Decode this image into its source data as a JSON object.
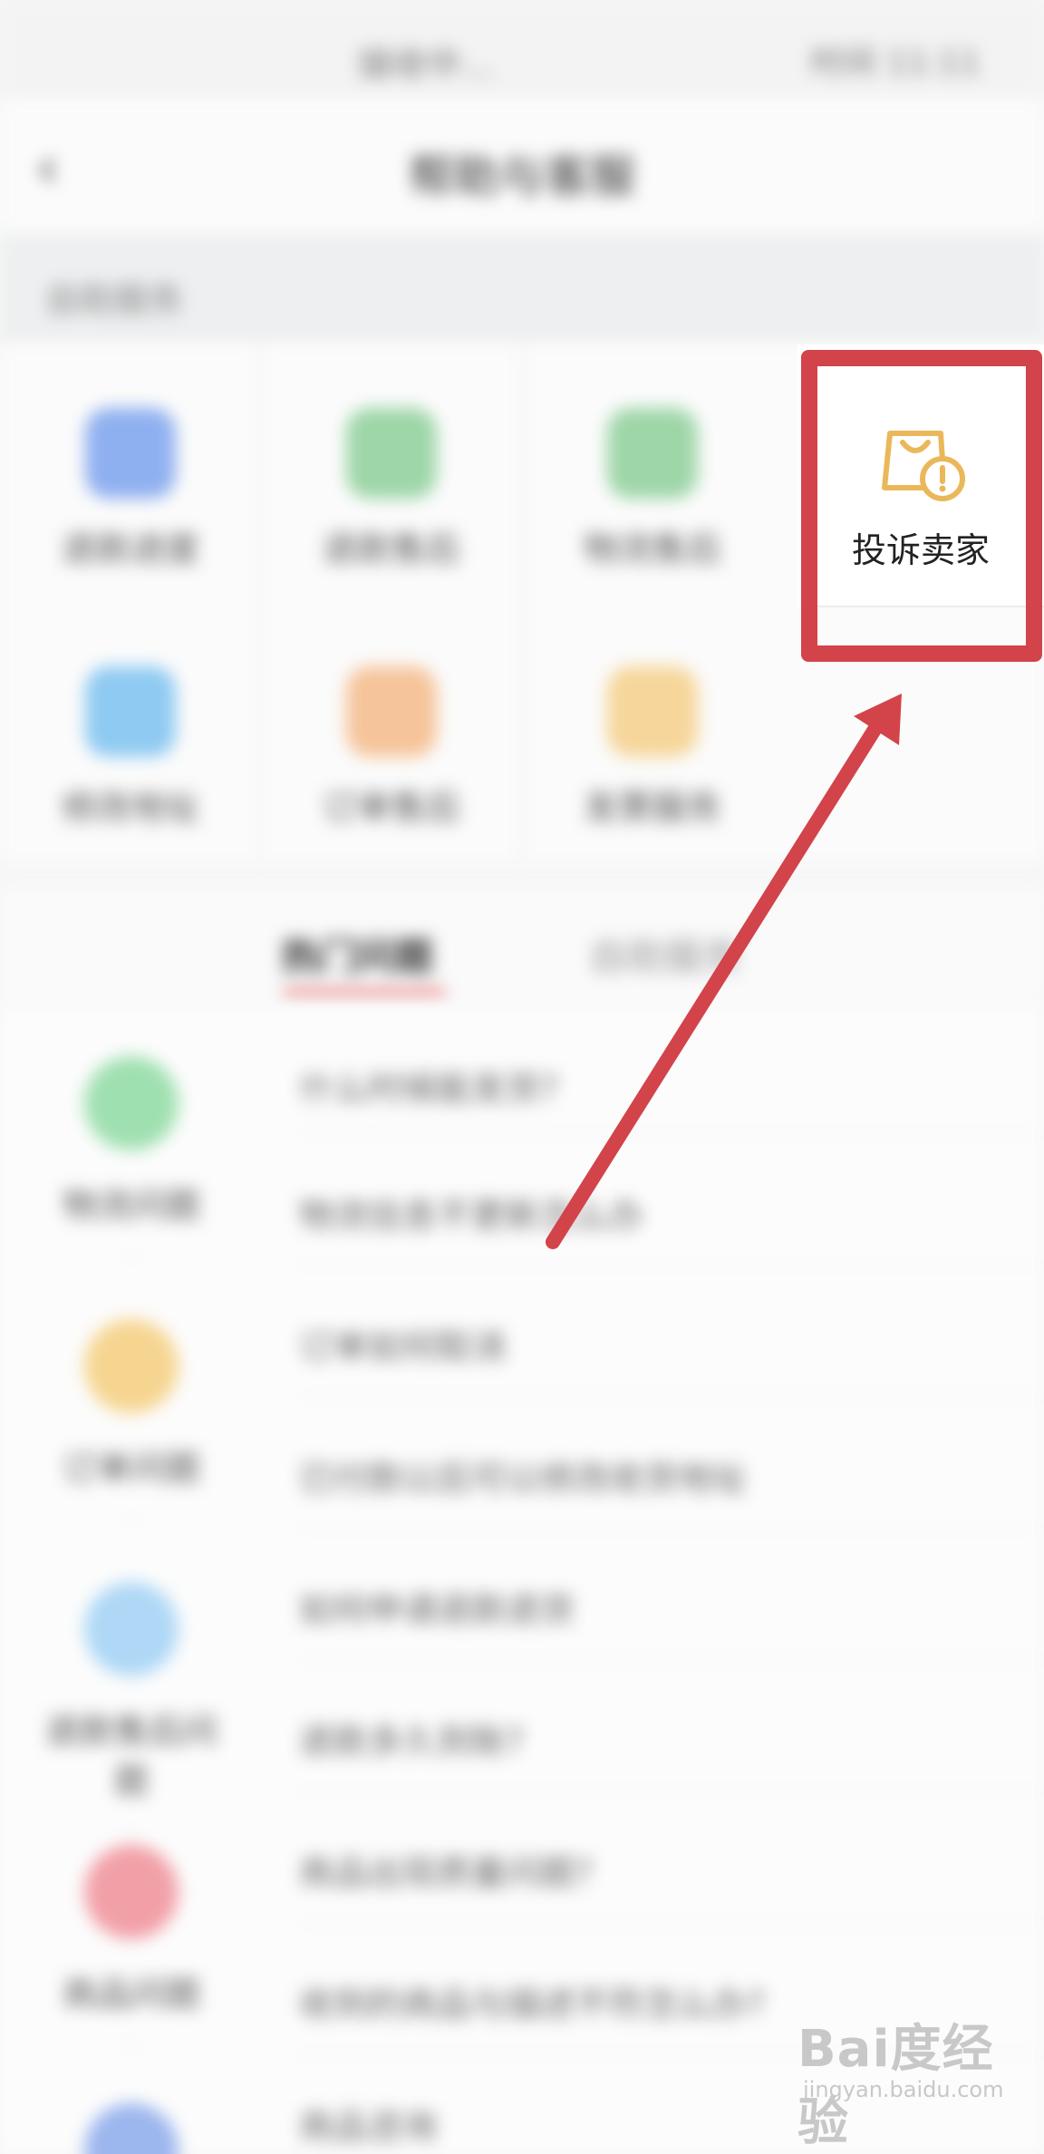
{
  "status_bar": {
    "center": "接收中...",
    "right": "时间 11:11"
  },
  "nav": {
    "back_glyph": "‹",
    "title": "帮助与客服"
  },
  "section": {
    "label": "自助服务"
  },
  "services": [
    {
      "label": "退款进度",
      "color": "#8fb0f0"
    },
    {
      "label": "退款售后",
      "color": "#9ed6a8"
    },
    {
      "label": "物流售后",
      "color": "#9ed6a8"
    },
    {
      "label": "修改地址",
      "color": "#8fcaf2"
    },
    {
      "label": "订单售后",
      "color": "#f6c49a"
    },
    {
      "label": "发票服务",
      "color": "#f6d69a"
    }
  ],
  "complaint": {
    "label": "投诉卖家",
    "icon": "shopping-bag-alert-icon",
    "icon_color": "#eab85a"
  },
  "annotation": {
    "color": "#d3434a"
  },
  "tabs": {
    "active": "热门问题",
    "inactive": "自助服务"
  },
  "categories": [
    {
      "name": "物流问题",
      "dot": "·",
      "color": "#9fe0b0"
    },
    {
      "name": "订单问题",
      "dot": "·",
      "color": "#f6d590"
    },
    {
      "name": "退款售后问题",
      "dot": "·",
      "color": "#aed8f6"
    },
    {
      "name": "商品问题",
      "dot": "·",
      "color": "#f2a0a8"
    },
    {
      "name": "",
      "dot": "",
      "color": "#9cb6ee"
    }
  ],
  "questions": [
    "什么时候能发货?",
    "物流信息不更新怎么办",
    "订单如何取消",
    "已付款以后可以修改收货地址",
    "如何申请退款退货",
    "退款多久到账?",
    "商品出现质量问题?",
    "收到的商品与描述不符怎么办?",
    "商品咨询"
  ],
  "watermark": {
    "brand": "Bai度经验",
    "sub": "jingyan.baidu.com"
  }
}
